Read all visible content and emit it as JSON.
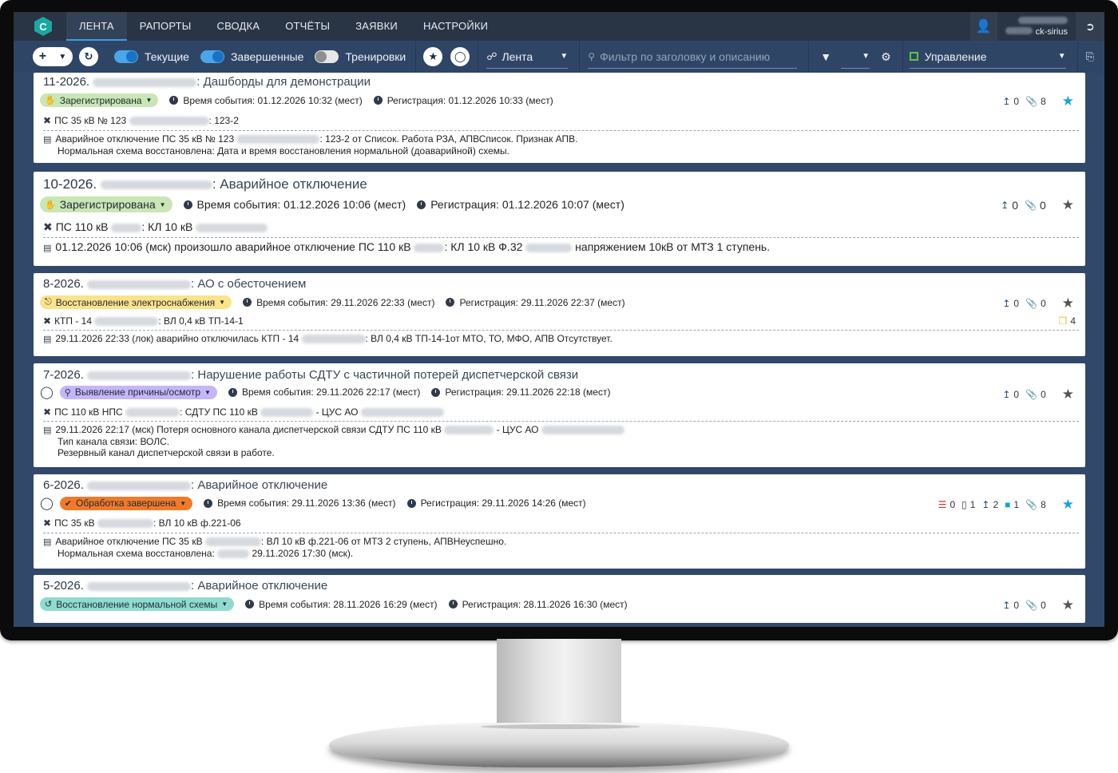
{
  "nav": {
    "logo": "C",
    "tabs": [
      "ЛЕНТА",
      "РАПОРТЫ",
      "СВОДКА",
      "ОТЧЁТЫ",
      "ЗАЯВКИ",
      "НАСТРОЙКИ"
    ],
    "user_name": "ck-sirius"
  },
  "toolbar": {
    "toggle_current": "Текущие",
    "toggle_done": "Завершенные",
    "toggle_training": "Тренировки",
    "view_select": "Лента",
    "filter_placeholder": "Фильтр по заголовку и описанию",
    "control_select": "Управление"
  },
  "cards": [
    {
      "number": "11-2026.",
      "title": ": Дашборды для демонстрации",
      "status": "Зарегистрирована",
      "event_time": "Время события: 01.12.2026 10:32 (мест)",
      "reg_time": "Регистрация: 01.12.2026 10:33 (мест)",
      "counters": [
        "0",
        "8"
      ],
      "starred": true,
      "object_a": "ПС 35 кВ № 123",
      "object_b": ": 123-2",
      "desc_a": "Аварийное отключение ПС 35 кВ № 123",
      "desc_b": ": 123-2 от Список. Работа РЗА, АПВСписок. Признак АПВ.",
      "desc_line2": "Нормальная схема восстановлена: Дата и время восстановления нормальной (доаварийной) схемы."
    },
    {
      "number": "10-2026.",
      "title": ": Аварийное отключение",
      "status": "Зарегистрирована",
      "event_time": "Время события: 01.12.2026 10:06 (мест)",
      "reg_time": "Регистрация: 01.12.2026 10:07 (мест)",
      "counters": [
        "0",
        "0"
      ],
      "starred": false,
      "object_a": "ПС 110 кВ",
      "object_b": ": КЛ 10 кВ",
      "desc_a": "01.12.2026 10:06 (мск) произошло аварийное отключение ПС 110 кВ",
      "desc_b": ": КЛ 10 кВ Ф.32",
      "desc_c": "напряжением 10кВ от МТЗ 1 ступень."
    },
    {
      "number": "8-2026.",
      "title": ": АО с обесточением",
      "status": "Восстановление электроснабжения",
      "event_time": "Время события: 29.11.2026 22:33 (мест)",
      "reg_time": "Регистрация: 29.11.2026 22:37 (мест)",
      "counters": [
        "0",
        "0"
      ],
      "starred": false,
      "extra_count": "4",
      "object_a": "КТП - 14",
      "object_b": ": ВЛ 0,4 кВ ТП-14-1",
      "desc_a": "29.11.2026 22:33 (лок) аварийно отключилась КТП - 14",
      "desc_b": ": ВЛ 0,4 кВ ТП-14-1от МТО, ТО, МФО, АПВ Отсутствует."
    },
    {
      "number": "7-2026.",
      "title": ": Нарушение работы СДТУ с частичной потерей диспетчерской связи",
      "status": "Выявление причины/осмотр",
      "event_time": "Время события: 29.11.2026 22:17 (мест)",
      "reg_time": "Регистрация: 29.11.2026 22:18 (мест)",
      "counters": [
        "0",
        "0"
      ],
      "starred": false,
      "object_a": "ПС 110 кВ НПС",
      "object_b": ": СДТУ ПС 110 кВ",
      "object_c": "- ЦУС АО",
      "desc_a": "29.11.2026 22:17 (мск) Потеря основного канала диспетчерской связи СДТУ ПС 110 кВ",
      "desc_b": "- ЦУС АО",
      "desc_line2": "Тип канала связи: ВОЛС.",
      "desc_line3": "Резервный канал диспетчерской связи в работе."
    },
    {
      "number": "6-2026.",
      "title": ": Аварийное отключение",
      "status": "Обработка завершена",
      "event_time": "Время события: 29.11.2026 13:36 (мест)",
      "reg_time": "Регистрация: 29.11.2026 14:26 (мест)",
      "counters6": [
        "0",
        "1",
        "2",
        "1",
        "8"
      ],
      "starred": true,
      "object_a": "ПС 35 кВ",
      "object_b": ": ВЛ 10 кВ ф.221-06",
      "desc_a": "Аварийное отключение ПС 35 кВ",
      "desc_b": ": ВЛ 10 кВ ф.221-06 от МТЗ 2 ступень, АПВНеуспешно.",
      "desc_line2a": "Нормальная схема восстановлена:",
      "desc_line2b": "29.11.2026 17:30 (мск)."
    },
    {
      "number": "5-2026.",
      "title": ": Аварийное отключение",
      "status": "Восстановление нормальной схемы",
      "event_time": "Время события: 28.11.2026 16:29 (мест)",
      "reg_time": "Регистрация: 28.11.2026 16:30 (мест)",
      "counters": [
        "0",
        "0"
      ],
      "starred": false
    }
  ],
  "colors": {
    "badge_registered": "#c9e6b4",
    "badge_restore_power": "#fce38a",
    "badge_inspection": "#c5b6f7",
    "badge_done": "#f07a2a",
    "badge_normal": "#8fdccf",
    "star_on": "#1aa0e8"
  }
}
